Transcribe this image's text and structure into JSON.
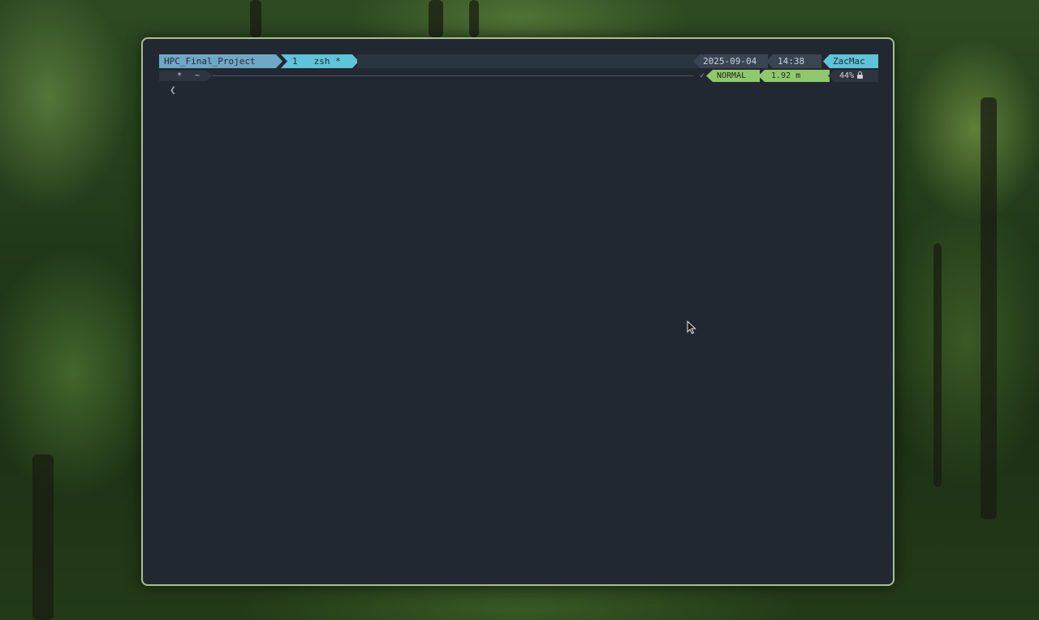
{
  "statusbar": {
    "session_name": "HPC_Final_Project",
    "window_index": "1",
    "window_name": "zsh",
    "window_flag": "*",
    "date": "2025-09-04",
    "time": "14:38",
    "hostname": "ZacMac"
  },
  "prompt": {
    "dir_flag": "*",
    "dir_path": "~",
    "status_icon": "check-icon",
    "status_glyph": "✓",
    "mode": "NORMAL",
    "duration": "1.92 m",
    "battery": "44%",
    "battery_icon": "lock-icon",
    "input_glyph": "❮"
  },
  "colors": {
    "terminal_bg": "#222832",
    "border": "#a9bf8f",
    "session_bg": "#6fa7c6",
    "window_bg": "#5ec4d9",
    "mode_bg": "#8fc96b"
  }
}
